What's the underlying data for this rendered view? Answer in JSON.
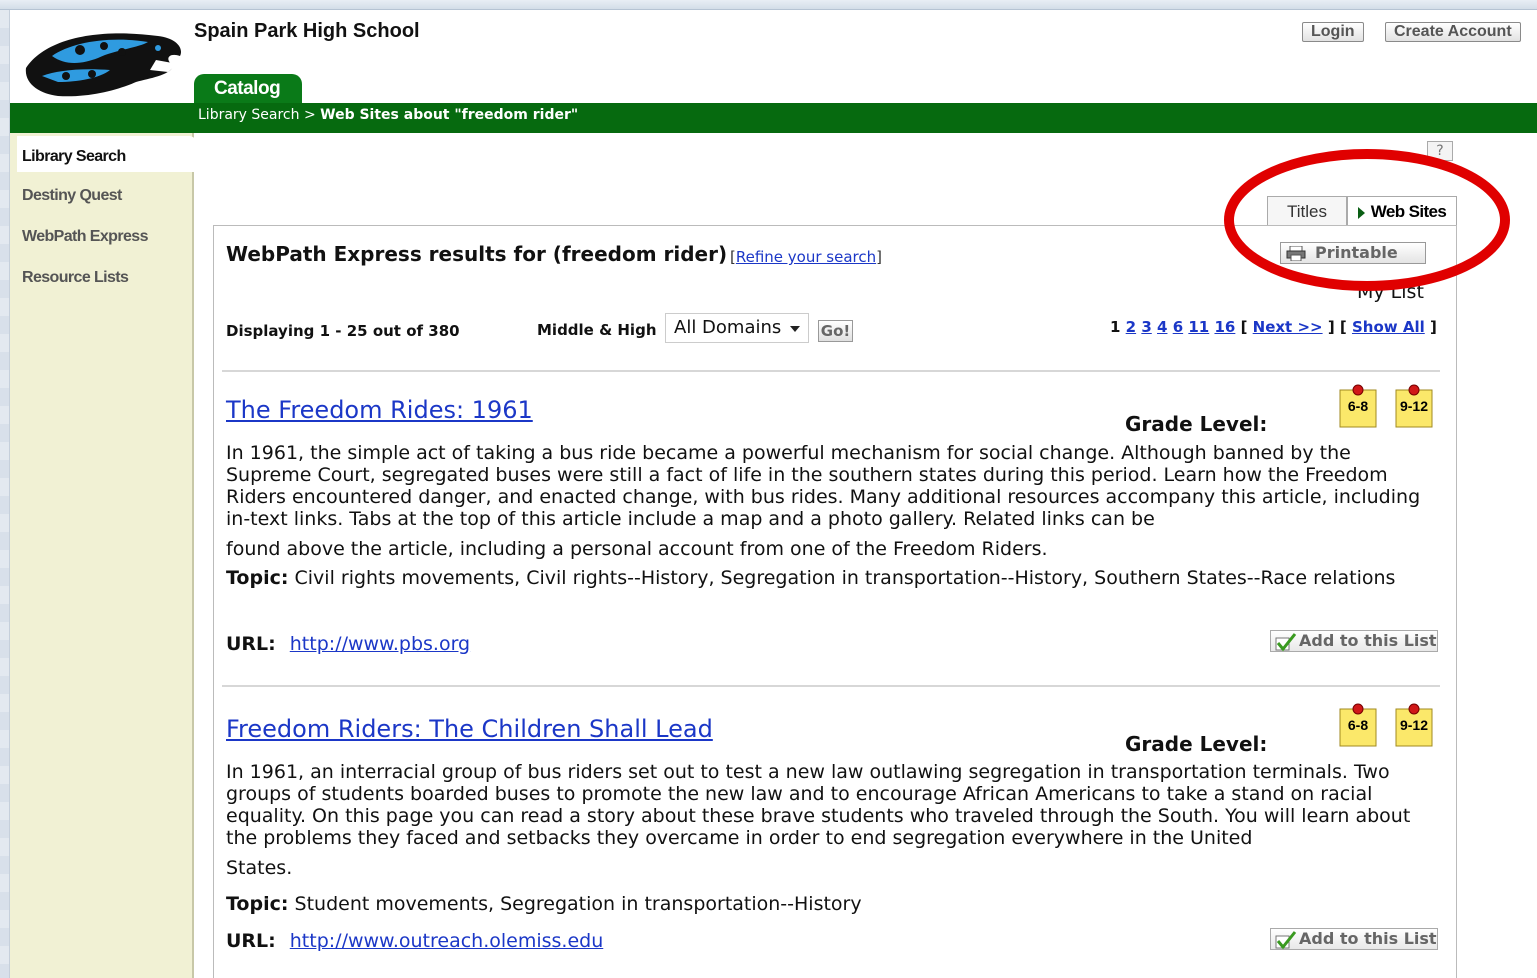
{
  "header": {
    "school_name": "Spain Park High School",
    "login_label": "Login",
    "create_account_label": "Create Account",
    "catalog_tab": "Catalog"
  },
  "breadcrumb": {
    "root": "Library Search",
    "separator": ">",
    "current": "Web Sites about \"freedom rider\""
  },
  "sidebar": {
    "items": [
      {
        "label": "Library Search"
      },
      {
        "label": "Destiny Quest"
      },
      {
        "label": "WebPath Express"
      },
      {
        "label": "Resource Lists"
      }
    ]
  },
  "help_label": "?",
  "result_tabs": {
    "titles": "Titles",
    "web_sites": "Web Sites"
  },
  "search": {
    "heading": "WebPath Express results for (freedom rider)",
    "refine_open": "[",
    "refine_label": "Refine your search",
    "refine_close": "]",
    "printable_label": "Printable",
    "my_list_label": "My List",
    "displaying": "Displaying 1 - 25 out of 380",
    "audience": "Middle & High",
    "domain_selected": "All Domains",
    "go_label": "Go!"
  },
  "pager": {
    "current": "1",
    "pages": [
      "2",
      "3",
      "4",
      "6",
      "11",
      "16"
    ],
    "next": "Next >>",
    "show_all": "Show All"
  },
  "results": [
    {
      "title": "The Freedom Rides: 1961",
      "grade_label": "Grade Level:",
      "grades": [
        "6-8",
        "9-12"
      ],
      "description": "In 1961, the simple act of taking a bus ride became a powerful mechanism for social change. Although banned by the Supreme Court, segregated buses were still a fact of life in the southern states during this period. Learn how the Freedom Riders encountered danger, and enacted change, with bus rides. Many additional resources accompany this article, including in-text links. Tabs at the top of this article include a map and a photo gallery. Related links can be",
      "description_tail": "found above the article, including a personal account from one of the Freedom Riders.",
      "topic_label": "Topic:",
      "topic": "Civil rights movements, Civil rights--History, Segregation in transportation--History, Southern States--Race relations",
      "url_label": "URL:",
      "url": "http://www.pbs.org",
      "add_label": "Add to this List"
    },
    {
      "title": "Freedom Riders: The Children Shall Lead",
      "grade_label": "Grade Level:",
      "grades": [
        "6-8",
        "9-12"
      ],
      "description": "In 1961, an interracial group of bus riders set out to test a new law outlawing segregation in transportation terminals. Two groups of students boarded buses to promote the new law and to encourage African Americans to take a stand on racial equality. On this page you can read a story about these brave students who traveled through the South. You will learn about the problems they faced and setbacks they overcame in order to end segregation everywhere in the United",
      "description_tail": "States.",
      "topic_label": "Topic:",
      "topic": "Student movements, Segregation in transportation--History",
      "url_label": "URL:",
      "url": "http://www.outreach.olemiss.edu",
      "add_label": "Add to this List"
    }
  ],
  "colors": {
    "brand_green": "#066a0f",
    "link_blue": "#1b37c7",
    "sidebar_bg": "#f1f1d4",
    "annotation_red": "#e00000"
  },
  "icons": [
    "jaguar-logo",
    "help-icon",
    "printer-icon",
    "checkmark-icon",
    "pushpin-note-icon",
    "dropdown-caret-icon"
  ]
}
